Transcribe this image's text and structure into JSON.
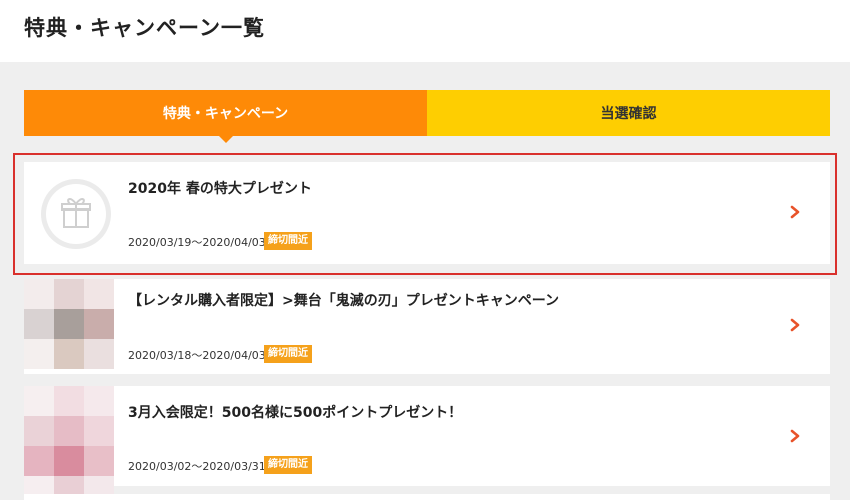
{
  "page": {
    "title": "特典・キャンペーン一覧"
  },
  "tabs": [
    {
      "label": "特典・キャンペーン",
      "active": true
    },
    {
      "label": "当選確認",
      "active": false
    }
  ],
  "campaigns": [
    {
      "title": "2020年 春の特大プレゼント",
      "date": "2020/03/19〜2020/04/03",
      "badge": "締切間近",
      "icon": "gift-icon"
    },
    {
      "title": "【レンタル購入者限定】>舞台「鬼滅の刃」プレゼントキャンペーン",
      "date": "2020/03/18〜2020/04/03",
      "badge": "締切間近",
      "icon": "thumbnail-image"
    },
    {
      "title": "3月入会限定！500名様に500ポイントプレゼント！",
      "date": "2020/03/02〜2020/03/31",
      "badge": "締切間近",
      "icon": "thumbnail-image"
    }
  ],
  "colors": {
    "tab_active": "#fe8a07",
    "tab_inactive": "#fece01",
    "badge": "#f5a11b",
    "chevron": "#e8532a",
    "highlight_border": "#d9302c"
  }
}
